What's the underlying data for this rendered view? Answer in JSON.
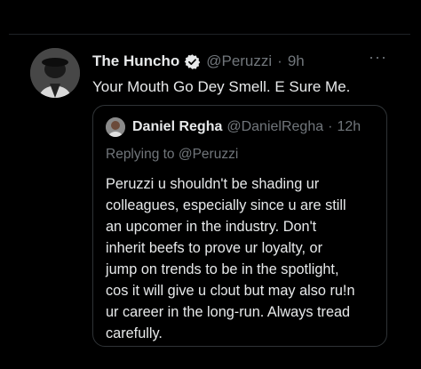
{
  "tweet": {
    "author_name": "The Huncho",
    "handle": "@Peruzzi",
    "separator": "·",
    "time": "9h",
    "text": "Your Mouth Go Dey Smell. E Sure Me.",
    "more_label": "···"
  },
  "quoted": {
    "author_name": "Daniel Regha",
    "handle": "@DanielRegha",
    "separator": "·",
    "time": "12h",
    "replying_prefix": "Replying to",
    "replying_handle": "@Peruzzi",
    "lines": [
      "Peruzzi u shouldn't be shading ur",
      "colleagues, especially since u are still",
      "an upcomer in the industry. Don't",
      "inherit beefs to prove ur loyalty, or",
      "jump on trends to be in the spotlight,",
      "cos it will give u clɔut but may also ru!n",
      "ur career in the long-run. Always tread",
      "carefully."
    ]
  },
  "colors": {
    "background": "#000000",
    "text": "#e7e9ea",
    "muted": "#71767b",
    "verified": "#1d9bf0",
    "border": "#2f3336"
  },
  "icons": {
    "verified": "verified-badge-icon",
    "more": "more-options-icon"
  }
}
